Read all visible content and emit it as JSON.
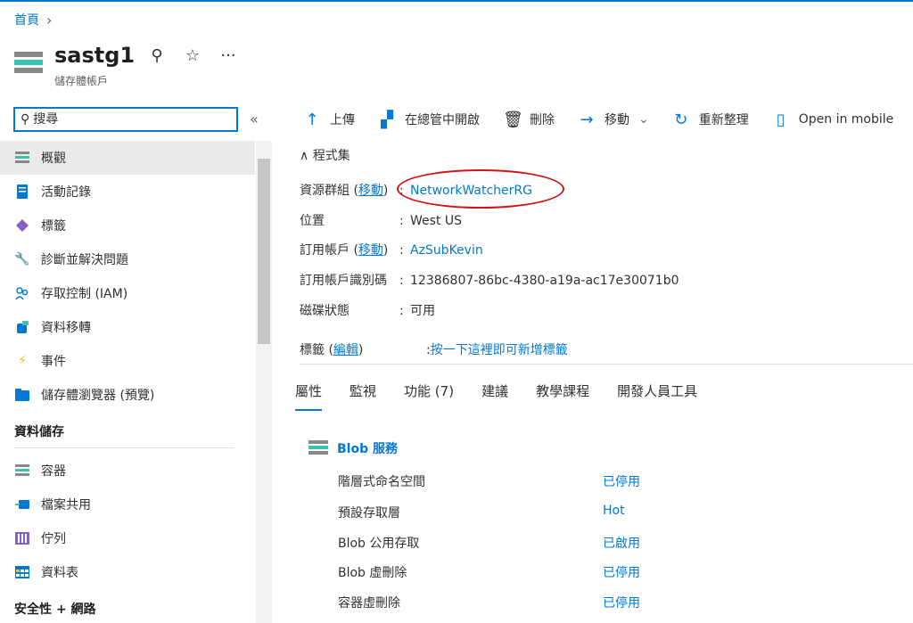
{
  "breadcrumb": {
    "home": "首頁",
    "sep": "›"
  },
  "header": {
    "title": "sastg1",
    "subtitle": "儲存體帳戶",
    "pin": "📌",
    "star": "☆",
    "more": "···"
  },
  "search": {
    "placeholder": "搜尋",
    "collapse": "«"
  },
  "nav": {
    "items": [
      {
        "label": "概觀"
      },
      {
        "label": "活動記錄"
      },
      {
        "label": "標籤"
      },
      {
        "label": "診斷並解決問題"
      },
      {
        "label": "存取控制 (IAM)"
      },
      {
        "label": "資料移轉"
      },
      {
        "label": "事件"
      },
      {
        "label": "儲存體瀏覽器 (預覽)"
      }
    ],
    "section1": "資料儲存",
    "storage_items": [
      {
        "label": "容器"
      },
      {
        "label": "檔案共用"
      },
      {
        "label": "佇列"
      },
      {
        "label": "資料表"
      }
    ],
    "section2": "安全性 + 網路"
  },
  "toolbar": {
    "upload": "上傳",
    "open_explorer": "在總管中開啟",
    "delete": "刪除",
    "move": "移動",
    "refresh": "重新整理",
    "mobile": "Open in mobile"
  },
  "essentials": {
    "toggle": "∧ 程式集",
    "rg_label": "資源群組",
    "move_link": "移動",
    "rg_value": "NetworkWatcherRG",
    "location_label": "位置",
    "location_value": "West US",
    "sub_label": "訂用帳戶",
    "sub_value": "AzSubKevin",
    "subid_label": "訂用帳戶識別碼",
    "subid_value": "12386807-86bc-4380-a19a-ac17e30071b0",
    "disk_label": "磁碟狀態",
    "disk_value": "可用",
    "tags_label": "標籤",
    "tags_edit": "編輯",
    "tags_value": "按一下這裡即可新增標籤"
  },
  "tabs": [
    "屬性",
    "監視",
    "功能 (7)",
    "建議",
    "教學課程",
    "開發人員工具"
  ],
  "blob": {
    "title": "Blob 服務",
    "props": [
      {
        "k": "階層式命名空間",
        "v": "已停用"
      },
      {
        "k": "預設存取層",
        "v": "Hot"
      },
      {
        "k": "Blob 公用存取",
        "v": "已啟用"
      },
      {
        "k": "Blob 虛刪除",
        "v": "已停用"
      },
      {
        "k": "容器虛刪除",
        "v": "已停用"
      }
    ]
  },
  "colors": {
    "accent": "#0078d4",
    "highlight": "#d01414"
  }
}
